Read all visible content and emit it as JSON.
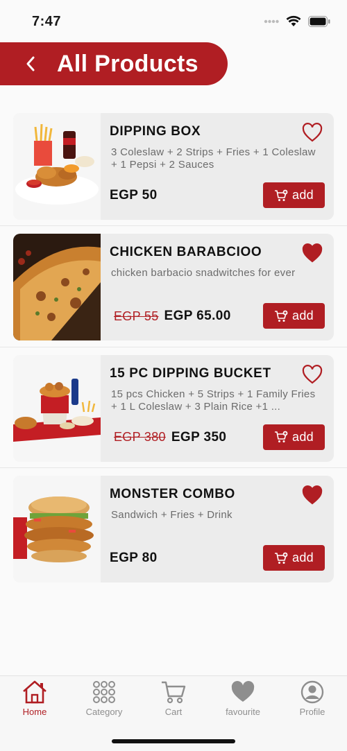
{
  "status": {
    "time": "7:47"
  },
  "header": {
    "title": "All Products",
    "back_icon": "chevron-left-icon"
  },
  "colors": {
    "brand": "#b01e23",
    "card": "#ececec",
    "inactive": "#8e8e8e"
  },
  "products": [
    {
      "name": "DIPPING BOX",
      "desc": "3 Coleslaw + 2 Strips + Fries + 1 Coleslaw + 1 Pepsi + 2 Sauces",
      "old_price": "",
      "price": "EGP 50",
      "favourite": false,
      "add_label": "add"
    },
    {
      "name": "CHICKEN BARABCIOO",
      "desc": "chicken barbacio snadwitches for ever",
      "old_price": "EGP 55",
      "price": "EGP 65.00",
      "favourite": true,
      "add_label": "add"
    },
    {
      "name": "15 PC DIPPING BUCKET",
      "desc": "15 pcs Chicken + 5 Strips + 1 Family Fries + 1 L Coleslaw + 3 Plain Rice +1 ...",
      "old_price": "EGP 380",
      "price": "EGP 350",
      "favourite": false,
      "add_label": "add"
    },
    {
      "name": "MONSTER COMBO",
      "desc": "Sandwich + Fries + Drink",
      "old_price": "",
      "price": "EGP 80",
      "favourite": true,
      "add_label": "add"
    }
  ],
  "nav": [
    {
      "label": "Home",
      "icon": "home-icon",
      "active": true
    },
    {
      "label": "Category",
      "icon": "grid-icon",
      "active": false
    },
    {
      "label": "Cart",
      "icon": "cart-icon",
      "active": false
    },
    {
      "label": "favourite",
      "icon": "heart-icon",
      "active": false
    },
    {
      "label": "Profile",
      "icon": "profile-icon",
      "active": false
    }
  ]
}
